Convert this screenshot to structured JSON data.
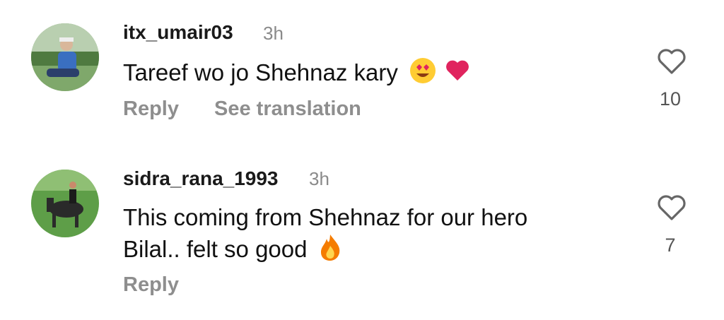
{
  "comments": [
    {
      "username": "itx_umair03",
      "time": "3h",
      "text": "Tareef wo jo Shehnaz kary",
      "emojis": [
        "heart-eyes-emoji",
        "red-heart-emoji"
      ],
      "actions": {
        "reply": "Reply",
        "translate": "See translation"
      },
      "likes": "10"
    },
    {
      "username": "sidra_rana_1993",
      "time": "3h",
      "text_line1": "This coming from Shehnaz for our hero",
      "text_line2": "Bilal.. felt so good",
      "emojis": [
        "fire-emoji"
      ],
      "actions": {
        "reply": "Reply"
      },
      "likes": "7"
    }
  ],
  "icons": {
    "like": "heart-outline-icon"
  },
  "colors": {
    "secondary_text": "#8e8e8e",
    "heart": "#e0245e",
    "fire": "#f57c00"
  }
}
